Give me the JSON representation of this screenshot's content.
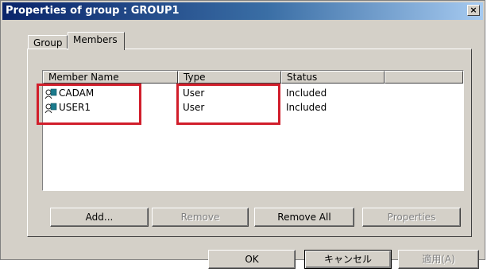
{
  "window": {
    "title": "Properties of group : GROUP1",
    "close_label": "×"
  },
  "tabs": [
    {
      "label": "Group",
      "active": false
    },
    {
      "label": "Members",
      "active": true
    }
  ],
  "list": {
    "columns": [
      "Member Name",
      "Type",
      "Status"
    ],
    "rows": [
      {
        "name": "CADAM",
        "type": "User",
        "status": "Included",
        "icon": "user-icon"
      },
      {
        "name": "USER1",
        "type": "User",
        "status": "Included",
        "icon": "user-icon"
      }
    ]
  },
  "panel_buttons": {
    "add": {
      "label": "Add...",
      "enabled": true
    },
    "remove": {
      "label": "Remove",
      "enabled": false
    },
    "remove_all": {
      "label": "Remove All",
      "enabled": true
    },
    "properties": {
      "label": "Properties",
      "enabled": false
    }
  },
  "dialog_buttons": {
    "ok": {
      "label": "OK",
      "enabled": true
    },
    "cancel": {
      "label": "キャンセル",
      "enabled": true
    },
    "apply": {
      "label": "適用(A)",
      "enabled": false
    }
  },
  "colors": {
    "annotation_red": "#d11e2b",
    "titlebar_start": "#0a246a",
    "titlebar_end": "#a6caf0",
    "dialog_face": "#d4d0c8"
  }
}
